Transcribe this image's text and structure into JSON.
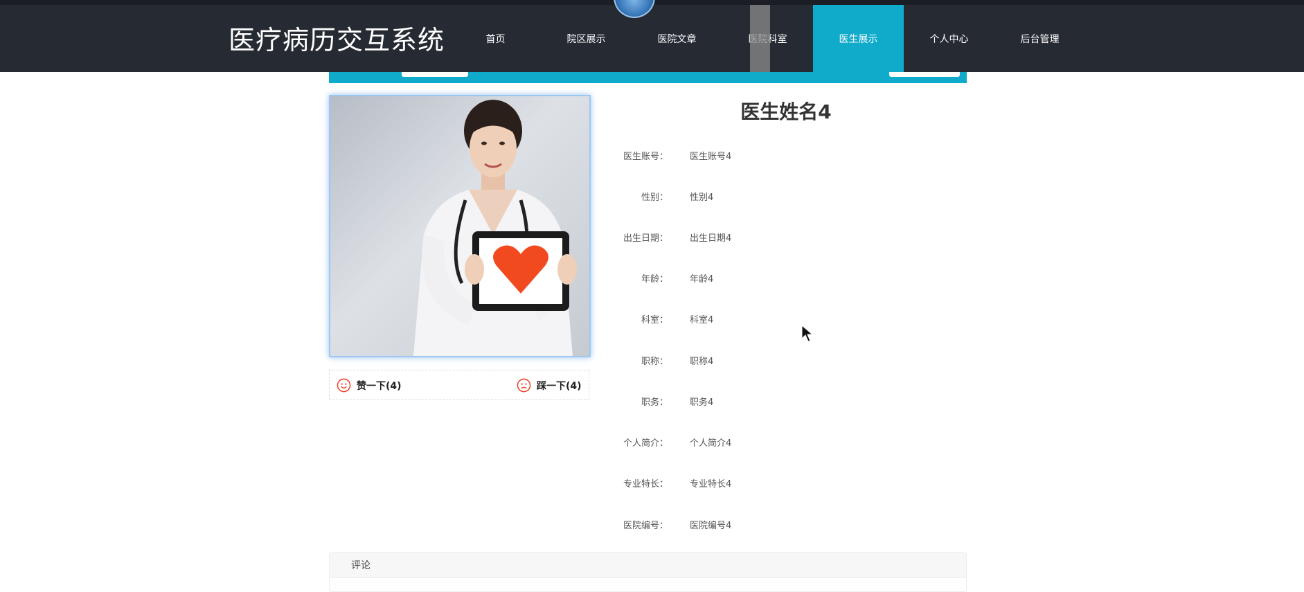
{
  "header": {
    "site_title": "医疗病历交互系统",
    "nav": [
      {
        "label": "首页",
        "active": false
      },
      {
        "label": "院区展示",
        "active": false
      },
      {
        "label": "医院文章",
        "active": false
      },
      {
        "label": "医院科室",
        "active": false
      },
      {
        "label": "医生展示",
        "active": true
      },
      {
        "label": "个人中心",
        "active": false
      },
      {
        "label": "后台管理",
        "active": false
      }
    ]
  },
  "colors": {
    "header_bg": "#262a33",
    "accent": "#10aacb"
  },
  "doctor": {
    "name": "医生姓名4",
    "fields": [
      {
        "label": "医生账号：",
        "value": "医生账号4"
      },
      {
        "label": "性别：",
        "value": "性别4"
      },
      {
        "label": "出生日期：",
        "value": "出生日期4"
      },
      {
        "label": "年龄：",
        "value": "年龄4"
      },
      {
        "label": "科室：",
        "value": "科室4"
      },
      {
        "label": "职称：",
        "value": "职称4"
      },
      {
        "label": "职务：",
        "value": "职务4"
      },
      {
        "label": "个人简介：",
        "value": "个人简介4"
      },
      {
        "label": "专业特长：",
        "value": "专业特长4"
      },
      {
        "label": "医院编号：",
        "value": "医院编号4"
      }
    ]
  },
  "votes": {
    "like_label": "赞一下(4)",
    "dislike_label": "踩一下(4)"
  },
  "comments": {
    "title": "评论"
  }
}
